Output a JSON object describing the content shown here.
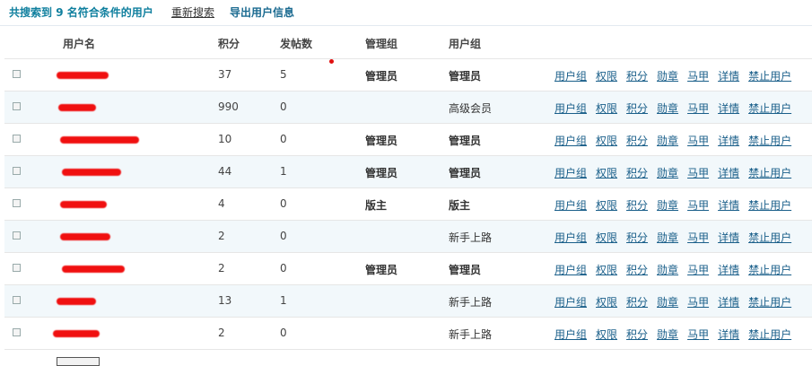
{
  "header": {
    "summary_prefix": "共搜索到",
    "count": "9",
    "summary_suffix": "名符合条件的用户",
    "research_link": "重新搜索",
    "export_link": "导出用户信息"
  },
  "columns": {
    "username": "用户名",
    "points": "积分",
    "posts": "发帖数",
    "admin_group": "管理组",
    "user_group": "用户组"
  },
  "actions": [
    "用户组",
    "权限",
    "积分",
    "勋章",
    "马甲",
    "详情",
    "禁止用户"
  ],
  "rows": [
    {
      "points": "37",
      "posts": "5",
      "admin_group": "管理员",
      "user_group": "管理员",
      "user_group_bold": true
    },
    {
      "points": "990",
      "posts": "0",
      "admin_group": "",
      "user_group": "高级会员",
      "user_group_bold": false
    },
    {
      "points": "10",
      "posts": "0",
      "admin_group": "管理员",
      "user_group": "管理员",
      "user_group_bold": true
    },
    {
      "points": "44",
      "posts": "1",
      "admin_group": "管理员",
      "user_group": "管理员",
      "user_group_bold": true
    },
    {
      "points": "4",
      "posts": "0",
      "admin_group": "版主",
      "user_group": "版主",
      "user_group_bold": true
    },
    {
      "points": "2",
      "posts": "0",
      "admin_group": "",
      "user_group": "新手上路",
      "user_group_bold": false
    },
    {
      "points": "2",
      "posts": "0",
      "admin_group": "管理员",
      "user_group": "管理员",
      "user_group_bold": true
    },
    {
      "points": "13",
      "posts": "1",
      "admin_group": "",
      "user_group": "新手上路",
      "user_group_bold": false
    },
    {
      "points": "2",
      "posts": "0",
      "admin_group": "",
      "user_group": "新手上路",
      "user_group_bold": false
    }
  ],
  "colors": {
    "summary": "#0f7f9e",
    "link": "#1a5f8a",
    "alt_row": "#f2f8fb",
    "redaction": "#f01010"
  }
}
